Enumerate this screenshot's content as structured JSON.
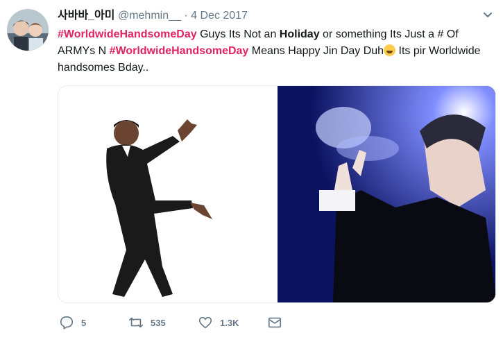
{
  "tweet": {
    "display_name": "사바바_아미",
    "handle": "@mehmin__",
    "separator": "·",
    "date": "4 Dec 2017",
    "text": {
      "hashtag_1": "#WorldwideHandsomeDay",
      "part_1": " Guys Its Not an ",
      "bold_1": "Holiday",
      "part_2": " or something Its Just a # Of ARMYs N ",
      "hashtag_2": "#WorldwideHandsomeDay",
      "part_3": " Means Happy Jin Day Duh",
      "part_4": " Its pir Worldwide handsomes Bday.."
    },
    "emoji": "face-with-tears-of-joy-emoji"
  },
  "actions": {
    "reply_count": "5",
    "retweet_count": "535",
    "like_count": "1.3K"
  },
  "icons": {
    "caret": "chevron-down-icon",
    "reply": "reply-icon",
    "retweet": "retweet-icon",
    "like": "heart-icon",
    "dm": "envelope-icon"
  },
  "colors": {
    "hashtag": "#e0245e",
    "secondary_text": "#657786",
    "right_image_bg": "#0b1260"
  }
}
